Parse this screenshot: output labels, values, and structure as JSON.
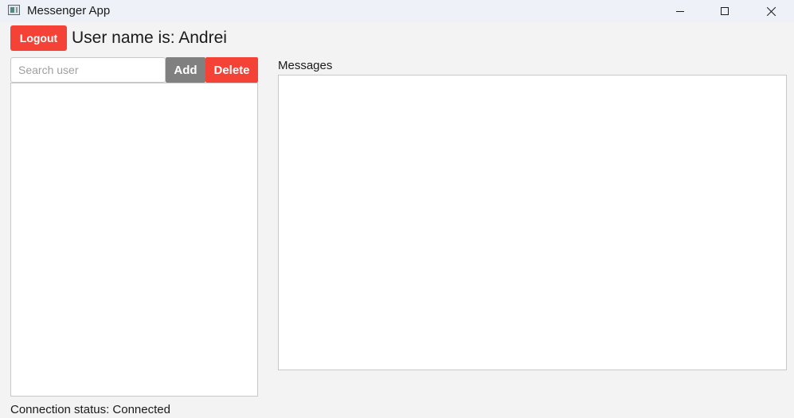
{
  "window": {
    "title": "Messenger App",
    "icons": {
      "app": "app-window-icon",
      "minimize": "minimize-icon",
      "maximize": "maximize-icon",
      "close": "close-icon"
    }
  },
  "header": {
    "logout_label": "Logout",
    "username_text": "User name is: Andrei"
  },
  "users": {
    "search_placeholder": "Search user",
    "search_value": "",
    "add_label": "Add",
    "delete_label": "Delete",
    "items": []
  },
  "messages": {
    "label": "Messages",
    "items": []
  },
  "status": {
    "text": "Connection status: Connected"
  },
  "colors": {
    "danger": "#f44336",
    "neutral_button": "#808080",
    "background": "#f3f3f3",
    "titlebar": "#eef1f7"
  }
}
